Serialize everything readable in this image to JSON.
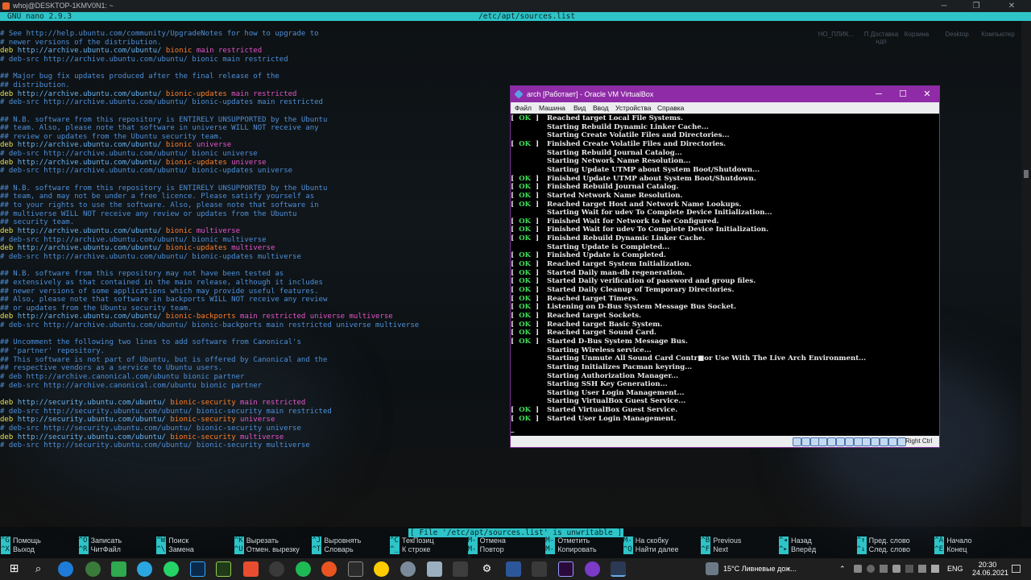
{
  "terminal": {
    "title": "whoj@DESKTOP-1KMV0N1: ~",
    "nano_version": "GNU nano 2.9.3",
    "filename": "/etc/apt/sources.list",
    "status_message": "[ File '/etc/apt/sources.list' is unwritable ]",
    "lines": [
      [
        {
          "c": "comment",
          "t": "# See http://help.ubuntu.com/community/UpgradeNotes for how to upgrade to"
        }
      ],
      [
        {
          "c": "comment",
          "t": "# newer versions of the distribution."
        }
      ],
      [
        {
          "c": "deb",
          "t": "deb "
        },
        {
          "c": "url",
          "t": "http://archive.ubuntu.com/ubuntu/ "
        },
        {
          "c": "dist",
          "t": "bionic "
        },
        {
          "c": "comp",
          "t": "main restricted"
        }
      ],
      [
        {
          "c": "comment",
          "t": "# deb-src http://archive.ubuntu.com/ubuntu/ bionic main restricted"
        }
      ],
      [],
      [
        {
          "c": "comment",
          "t": "## Major bug fix updates produced after the final release of the"
        }
      ],
      [
        {
          "c": "comment",
          "t": "## distribution."
        }
      ],
      [
        {
          "c": "deb",
          "t": "deb "
        },
        {
          "c": "url",
          "t": "http://archive.ubuntu.com/ubuntu/ "
        },
        {
          "c": "dist",
          "t": "bionic-updates "
        },
        {
          "c": "comp",
          "t": "main restricted"
        }
      ],
      [
        {
          "c": "comment",
          "t": "# deb-src http://archive.ubuntu.com/ubuntu/ bionic-updates main restricted"
        }
      ],
      [],
      [
        {
          "c": "comment",
          "t": "## N.B. software from this repository is ENTIRELY UNSUPPORTED by the Ubuntu"
        }
      ],
      [
        {
          "c": "comment",
          "t": "## team. Also, please note that software in universe WILL NOT receive any"
        }
      ],
      [
        {
          "c": "comment",
          "t": "## review or updates from the Ubuntu security team."
        }
      ],
      [
        {
          "c": "deb",
          "t": "deb "
        },
        {
          "c": "url",
          "t": "http://archive.ubuntu.com/ubuntu/ "
        },
        {
          "c": "dist",
          "t": "bionic "
        },
        {
          "c": "comp",
          "t": "universe"
        }
      ],
      [
        {
          "c": "comment",
          "t": "# deb-src http://archive.ubuntu.com/ubuntu/ bionic universe"
        }
      ],
      [
        {
          "c": "deb",
          "t": "deb "
        },
        {
          "c": "url",
          "t": "http://archive.ubuntu.com/ubuntu/ "
        },
        {
          "c": "dist",
          "t": "bionic-updates "
        },
        {
          "c": "comp",
          "t": "universe"
        }
      ],
      [
        {
          "c": "comment",
          "t": "# deb-src http://archive.ubuntu.com/ubuntu/ bionic-updates universe"
        }
      ],
      [],
      [
        {
          "c": "comment",
          "t": "## N.B. software from this repository is ENTIRELY UNSUPPORTED by the Ubuntu"
        }
      ],
      [
        {
          "c": "comment",
          "t": "## team, and may not be under a free licence. Please satisfy yourself as"
        }
      ],
      [
        {
          "c": "comment",
          "t": "## to your rights to use the software. Also, please note that software in"
        }
      ],
      [
        {
          "c": "comment",
          "t": "## multiverse WILL NOT receive any review or updates from the Ubuntu"
        }
      ],
      [
        {
          "c": "comment",
          "t": "## security team."
        }
      ],
      [
        {
          "c": "deb",
          "t": "deb "
        },
        {
          "c": "url",
          "t": "http://archive.ubuntu.com/ubuntu/ "
        },
        {
          "c": "dist",
          "t": "bionic "
        },
        {
          "c": "comp",
          "t": "multiverse"
        }
      ],
      [
        {
          "c": "comment",
          "t": "# deb-src http://archive.ubuntu.com/ubuntu/ bionic multiverse"
        }
      ],
      [
        {
          "c": "deb",
          "t": "deb "
        },
        {
          "c": "url",
          "t": "http://archive.ubuntu.com/ubuntu/ "
        },
        {
          "c": "dist",
          "t": "bionic-updates "
        },
        {
          "c": "comp",
          "t": "multiverse"
        }
      ],
      [
        {
          "c": "comment",
          "t": "# deb-src http://archive.ubuntu.com/ubuntu/ bionic-updates multiverse"
        }
      ],
      [],
      [
        {
          "c": "comment",
          "t": "## N.B. software from this repository may not have been tested as"
        }
      ],
      [
        {
          "c": "comment",
          "t": "## extensively as that contained in the main release, although it includes"
        }
      ],
      [
        {
          "c": "comment",
          "t": "## newer versions of some applications which may provide useful features."
        }
      ],
      [
        {
          "c": "comment",
          "t": "## Also, please note that software in backports WILL NOT receive any review"
        }
      ],
      [
        {
          "c": "comment",
          "t": "## or updates from the Ubuntu security team."
        }
      ],
      [
        {
          "c": "deb",
          "t": "deb "
        },
        {
          "c": "url",
          "t": "http://archive.ubuntu.com/ubuntu/ "
        },
        {
          "c": "dist",
          "t": "bionic-backports "
        },
        {
          "c": "comp",
          "t": "main restricted universe multiverse"
        }
      ],
      [
        {
          "c": "comment",
          "t": "# deb-src http://archive.ubuntu.com/ubuntu/ bionic-backports main restricted universe multiverse"
        }
      ],
      [],
      [
        {
          "c": "comment",
          "t": "## Uncomment the following two lines to add software from Canonical's"
        }
      ],
      [
        {
          "c": "comment",
          "t": "## 'partner' repository."
        }
      ],
      [
        {
          "c": "comment",
          "t": "## This software is not part of Ubuntu, but is offered by Canonical and the"
        }
      ],
      [
        {
          "c": "comment",
          "t": "## respective vendors as a service to Ubuntu users."
        }
      ],
      [
        {
          "c": "comment",
          "t": "# deb http://archive.canonical.com/ubuntu bionic partner"
        }
      ],
      [
        {
          "c": "comment",
          "t": "# deb-src http://archive.canonical.com/ubuntu bionic partner"
        }
      ],
      [],
      [
        {
          "c": "deb",
          "t": "deb "
        },
        {
          "c": "url",
          "t": "http://security.ubuntu.com/ubuntu/ "
        },
        {
          "c": "dist",
          "t": "bionic-security "
        },
        {
          "c": "comp",
          "t": "main restricted"
        }
      ],
      [
        {
          "c": "comment",
          "t": "# deb-src http://security.ubuntu.com/ubuntu/ bionic-security main restricted"
        }
      ],
      [
        {
          "c": "deb",
          "t": "deb "
        },
        {
          "c": "url",
          "t": "http://security.ubuntu.com/ubuntu/ "
        },
        {
          "c": "dist",
          "t": "bionic-security "
        },
        {
          "c": "comp",
          "t": "universe"
        }
      ],
      [
        {
          "c": "comment",
          "t": "# deb-src http://security.ubuntu.com/ubuntu/ bionic-security universe"
        }
      ],
      [
        {
          "c": "deb",
          "t": "deb "
        },
        {
          "c": "url",
          "t": "http://security.ubuntu.com/ubuntu/ "
        },
        {
          "c": "dist",
          "t": "bionic-security "
        },
        {
          "c": "comp",
          "t": "multiverse"
        }
      ],
      [
        {
          "c": "comment",
          "t": "# deb-src http://security.ubuntu.com/ubuntu/ bionic-security multiverse"
        }
      ]
    ],
    "shortcuts": [
      {
        "key": "^G",
        "label": "Помощь"
      },
      {
        "key": "^X",
        "label": "Выход"
      },
      {
        "key": "^O",
        "label": "Записать"
      },
      {
        "key": "^R",
        "label": "ЧитФайл"
      },
      {
        "key": "^W",
        "label": "Поиск"
      },
      {
        "key": "^\\",
        "label": "Замена"
      },
      {
        "key": "^K",
        "label": "Вырезать"
      },
      {
        "key": "^U",
        "label": "Отмен. вырезку"
      },
      {
        "key": "^J",
        "label": "Выровнять"
      },
      {
        "key": "^T",
        "label": "Словарь"
      },
      {
        "key": "^C",
        "label": "ТекПозиц"
      },
      {
        "key": "^_",
        "label": "К строке"
      },
      {
        "key": "M-U",
        "label": "Отмена"
      },
      {
        "key": "M-E",
        "label": "Повтор"
      },
      {
        "key": "M-A",
        "label": "Отметить"
      },
      {
        "key": "M-6",
        "label": "Копировать"
      },
      {
        "key": "M-]",
        "label": "На скобку"
      },
      {
        "key": "^Q",
        "label": "Найти далее"
      },
      {
        "key": "^B",
        "label": "Previous"
      },
      {
        "key": "^F",
        "label": "Next"
      },
      {
        "key": "^◂",
        "label": "Назад"
      },
      {
        "key": "^▸",
        "label": "Вперёд"
      },
      {
        "key": "^↑",
        "label": "Пред. слово"
      },
      {
        "key": "^↓",
        "label": "След. слово"
      },
      {
        "key": "^A",
        "label": "Начало"
      },
      {
        "key": "^E",
        "label": "Конец"
      }
    ],
    "desktop_icons": [
      "НО_ПЛИК...",
      "П Доставка",
      "Корзина",
      "Desktop",
      "Компьютер"
    ],
    "desktop_icons_sub": [
      "",
      "ндп",
      "",
      "",
      ""
    ]
  },
  "vbox": {
    "title": "arch [Работает] - Oracle VM VirtualBox",
    "menu": [
      "Файл",
      "Машина",
      "Вид",
      "Ввод",
      "Устройства",
      "Справка"
    ],
    "host_key": "Right Ctrl",
    "boot_lines": [
      {
        "s": "ok",
        "verb": "Reached",
        "t": "target",
        "rest": " Local File Systems."
      },
      {
        "s": "",
        "verb": "Starting",
        "t": "",
        "rest": " Rebuild Dynamic Linker Cache..."
      },
      {
        "s": "",
        "verb": "Starting",
        "t": "",
        "rest": " Create Volatile Files and Directories..."
      },
      {
        "s": "ok",
        "verb": "Finished",
        "t": "",
        "rest": " Create Volatile Files and Directories."
      },
      {
        "s": "",
        "verb": "Starting",
        "t": "",
        "rest": " Rebuild Journal Catalog..."
      },
      {
        "s": "",
        "verb": "Starting",
        "t": "",
        "rest": " Network Name Resolution..."
      },
      {
        "s": "",
        "verb": "Starting",
        "t": "",
        "rest": " Update UTMP about System Boot/Shutdown..."
      },
      {
        "s": "ok",
        "verb": "Finished",
        "t": "",
        "rest": " Update UTMP about System Boot/Shutdown."
      },
      {
        "s": "ok",
        "verb": "Finished",
        "t": "",
        "rest": " Rebuild Journal Catalog."
      },
      {
        "s": "ok",
        "verb": "Started",
        "t": "",
        "rest": " Network Name Resolution."
      },
      {
        "s": "ok",
        "verb": "Reached",
        "t": "target",
        "rest": " Host and Network Name Lookups."
      },
      {
        "s": "",
        "verb": "Starting",
        "t": "",
        "rest": " Wait for udev To Complete Device Initialization..."
      },
      {
        "s": "ok",
        "verb": "Finished",
        "t": "",
        "rest": " Wait for Network to be Configured."
      },
      {
        "s": "ok",
        "verb": "Finished",
        "t": "",
        "rest": " Wait for udev To Complete Device Initialization."
      },
      {
        "s": "ok",
        "verb": "Finished",
        "t": "",
        "rest": " Rebuild Dynamic Linker Cache."
      },
      {
        "s": "",
        "verb": "Starting",
        "t": "",
        "rest": " Update is Completed..."
      },
      {
        "s": "ok",
        "verb": "Finished",
        "t": "",
        "rest": " Update is Completed."
      },
      {
        "s": "ok",
        "verb": "Reached",
        "t": "target",
        "rest": " System Initialization."
      },
      {
        "s": "ok",
        "verb": "Started",
        "t": "",
        "rest": " Daily man-db regeneration."
      },
      {
        "s": "ok",
        "verb": "Started",
        "t": "",
        "rest": " Daily verification of password and group files."
      },
      {
        "s": "ok",
        "verb": "Started",
        "t": "",
        "rest": " Daily Cleanup of Temporary Directories."
      },
      {
        "s": "ok",
        "verb": "Reached",
        "t": "target",
        "rest": " Timers."
      },
      {
        "s": "ok",
        "verb": "Listening",
        "t": "on",
        "rest": " D-Bus System Message Bus Socket."
      },
      {
        "s": "ok",
        "verb": "Reached",
        "t": "target",
        "rest": " Sockets."
      },
      {
        "s": "ok",
        "verb": "Reached",
        "t": "target",
        "rest": " Basic System."
      },
      {
        "s": "ok",
        "verb": "Reached",
        "t": "target",
        "rest": " Sound Card."
      },
      {
        "s": "ok",
        "verb": "Started",
        "t": "",
        "rest": " D-Bus System Message Bus."
      },
      {
        "s": "",
        "verb": "Starting",
        "t": "",
        "rest": " Wireless service..."
      },
      {
        "s": "",
        "verb": "Starting",
        "t": "",
        "rest": " Unmute All Sound Card Contr■or Use With The Live Arch Environment..."
      },
      {
        "s": "",
        "verb": "Starting",
        "t": "",
        "rest": " Initializes Pacman keyring..."
      },
      {
        "s": "",
        "verb": "Starting",
        "t": "",
        "rest": " Authorization Manager..."
      },
      {
        "s": "",
        "verb": "Starting",
        "t": "",
        "rest": " SSH Key Generation..."
      },
      {
        "s": "",
        "verb": "Starting",
        "t": "",
        "rest": " User Login Management..."
      },
      {
        "s": "",
        "verb": "Starting",
        "t": "",
        "rest": " VirtualBox Guest Service..."
      },
      {
        "s": "ok",
        "verb": "Started",
        "t": "",
        "rest": " VirtualBox Guest Service."
      },
      {
        "s": "ok",
        "verb": "Started",
        "t": "",
        "rest": " User Login Management."
      }
    ],
    "ok_label": "OK",
    "cursor": "_"
  },
  "taskbar": {
    "weather": "15°C  Ливневые дож...",
    "lang": "ENG",
    "time": "20:30",
    "date": "24.06.2021"
  },
  "colors": {
    "nano_bar": "#2ec4c8",
    "vbox_title": "#8f2ba7",
    "boot_ok": "#3fe05a"
  }
}
